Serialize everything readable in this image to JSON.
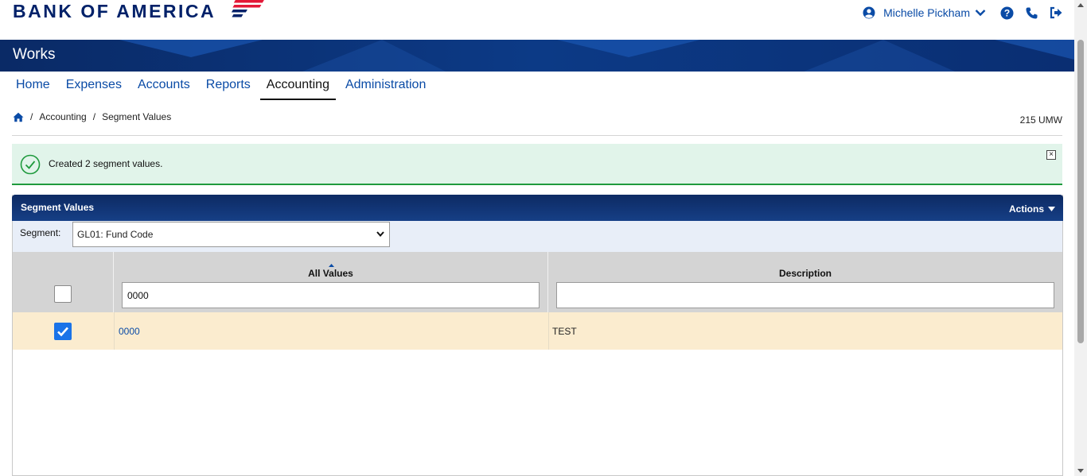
{
  "brand": {
    "logo_text": "BANK OF AMERICA",
    "color": "#012169"
  },
  "user": {
    "name": "Michelle Pickham",
    "icons": [
      "user-circle-icon",
      "chevron-down-icon",
      "help-icon",
      "phone-icon",
      "sign-out-icon"
    ]
  },
  "banner": {
    "title": "Works"
  },
  "nav": {
    "items": [
      {
        "label": "Home"
      },
      {
        "label": "Expenses"
      },
      {
        "label": "Accounts"
      },
      {
        "label": "Reports"
      },
      {
        "label": "Accounting",
        "active": true
      },
      {
        "label": "Administration"
      }
    ]
  },
  "breadcrumb": {
    "items": [
      "Accounting",
      "Segment Values"
    ],
    "site_code": "215 UMW"
  },
  "alert": {
    "message": "Created 2 segment values.",
    "close_glyph": "×",
    "color": "#1f9a3d"
  },
  "panel": {
    "title": "Segment Values",
    "actions_label": "Actions",
    "segment_label": "Segment:",
    "segment_value": "GL01: Fund Code"
  },
  "table": {
    "columns": [
      {
        "title": "All Values",
        "filter": "0000",
        "sorted": "asc"
      },
      {
        "title": "Description",
        "filter": ""
      }
    ],
    "rows": [
      {
        "checked": true,
        "value": "0000",
        "description": "TEST"
      }
    ]
  }
}
